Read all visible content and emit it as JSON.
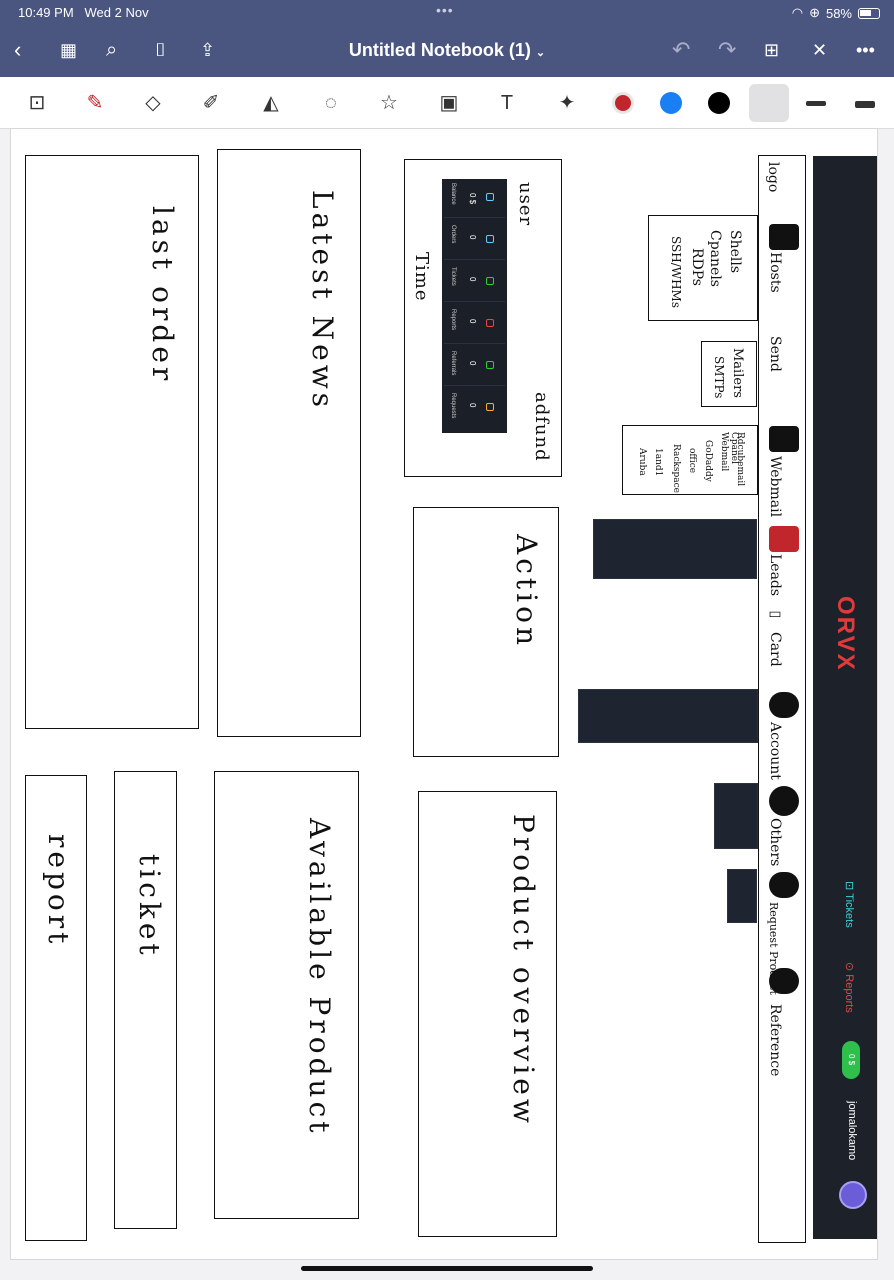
{
  "status_bar": {
    "time": "10:49 PM",
    "date": "Wed 2 Nov",
    "battery": "58%"
  },
  "nav": {
    "title": "Untitled Notebook (1)",
    "dropdown_icon": "chevron-down-icon"
  },
  "toolbar": {
    "tools": [
      "lasso-zoom-icon",
      "pen-icon",
      "eraser-icon",
      "highlighter-icon",
      "shapes-icon",
      "lasso-icon",
      "sticker-icon",
      "image-icon",
      "text-icon",
      "laser-icon"
    ],
    "colors": [
      "#c0262b",
      "#1a7ff2",
      "#000000"
    ]
  },
  "sketch": {
    "boxes": {
      "last_order": "last order",
      "latest_news": "Latest News",
      "time": "Time",
      "user": "user",
      "adfund": "adfund",
      "action": "Action",
      "product_overview": "Product overview",
      "available_product": "Available Product",
      "ticket": "ticket",
      "report": "report"
    },
    "dashboard": {
      "cells": [
        {
          "label": "Balance",
          "value": "0 $"
        },
        {
          "label": "Orders",
          "value": "0"
        },
        {
          "label": "Tickets",
          "value": "0"
        },
        {
          "label": "Reports",
          "value": "0"
        },
        {
          "label": "Referrals",
          "value": "0"
        },
        {
          "label": "Requests",
          "value": "0"
        }
      ]
    },
    "menu": {
      "items": [
        "logo",
        "Hosts",
        "Send",
        "Webmail",
        "Leads",
        "Card",
        "Account",
        "Others",
        "Request Product",
        "Reference"
      ]
    },
    "notes": {
      "hosts": [
        "Shells",
        "Cpanels",
        "RDPs",
        "SSH/WHMs"
      ],
      "send": [
        "Mailers",
        "SMTPs"
      ],
      "webmail": [
        "Rdcubemail",
        "Cpanel Webmail",
        "GoDaddy",
        "office",
        "Rackspace",
        "1and1",
        "Aruba"
      ]
    }
  },
  "orvx": {
    "logo": "ORVX",
    "tickets": "Tickets",
    "reports": "Reports",
    "balance": "0 $",
    "user": "jomalokamo"
  }
}
